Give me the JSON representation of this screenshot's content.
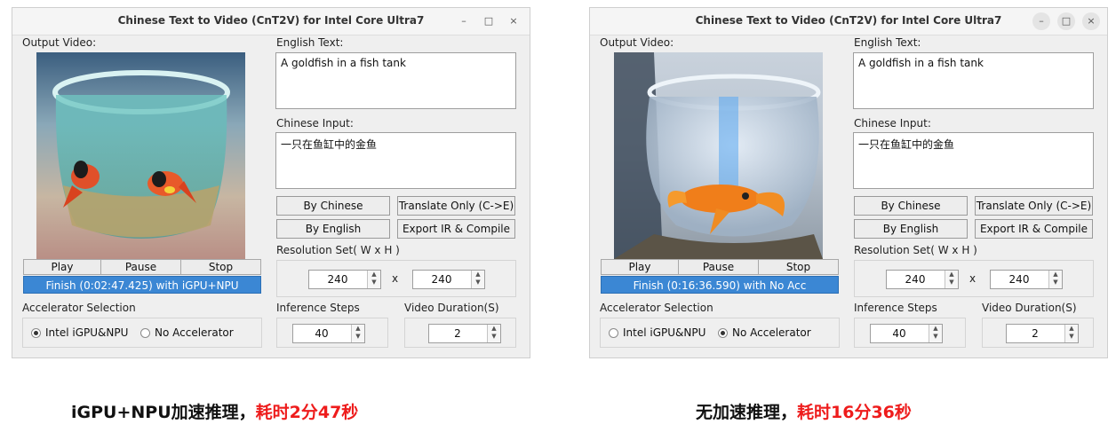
{
  "left_window": {
    "title": "Chinese Text to Video (CnT2V) for Intel Core Ultra7",
    "output_video_label": "Output Video:",
    "english_text_label": "English Text:",
    "english_text": "A goldfish in a fish tank",
    "chinese_input_label": "Chinese Input:",
    "chinese_input": "一只在鱼缸中的金鱼",
    "by_chinese": "By Chinese",
    "translate_only": "Translate Only (C->E)",
    "by_english": "By English",
    "export_ir": "Export IR & Compile",
    "resolution_label": "Resolution Set( W x H )",
    "res_w": "240",
    "res_x": "x",
    "res_h": "240",
    "play": "Play",
    "pause": "Pause",
    "stop": "Stop",
    "status": "Finish (0:02:47.425) with iGPU+NPU",
    "accel_label": "Accelerator Selection",
    "opt_npu": "Intel iGPU&NPU",
    "opt_none": "No Accelerator",
    "selected": "npu",
    "steps_label": "Inference Steps",
    "steps": "40",
    "duration_label": "Video Duration(S)",
    "duration": "2"
  },
  "right_window": {
    "title": "Chinese Text to Video (CnT2V) for Intel Core Ultra7",
    "output_video_label": "Output Video:",
    "english_text_label": "English Text:",
    "english_text": "A goldfish in a fish tank",
    "chinese_input_label": "Chinese Input:",
    "chinese_input": "一只在鱼缸中的金鱼",
    "by_chinese": "By Chinese",
    "translate_only": "Translate Only (C->E)",
    "by_english": "By English",
    "export_ir": "Export IR & Compile",
    "resolution_label": "Resolution Set( W x H )",
    "res_w": "240",
    "res_x": "x",
    "res_h": "240",
    "play": "Play",
    "pause": "Pause",
    "stop": "Stop",
    "status": "Finish (0:16:36.590) with No Acc",
    "accel_label": "Accelerator Selection",
    "opt_npu": "Intel iGPU&NPU",
    "opt_none": "No Accelerator",
    "selected": "none",
    "steps_label": "Inference Steps",
    "steps": "40",
    "duration_label": "Video Duration(S)",
    "duration": "2"
  },
  "window_controls": {
    "minimize": "–",
    "maximize": "□",
    "close": "×"
  },
  "captions": {
    "left_black": "iGPU+NPU加速推理，",
    "left_red": "耗时2分47秒",
    "right_black": "无加速推理，",
    "right_red": "耗时16分36秒"
  },
  "colors": {
    "accent": "#3b87d4",
    "caption_red": "#ee1c1c"
  }
}
